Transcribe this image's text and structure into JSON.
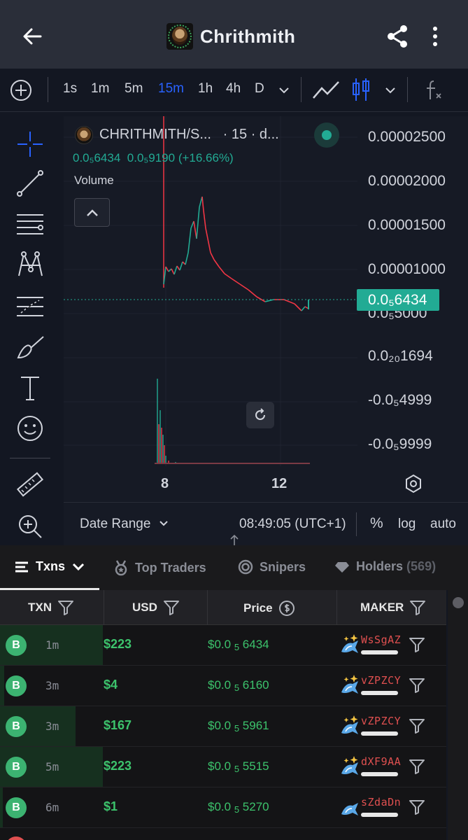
{
  "header": {
    "title": "Chrithmith",
    "icons": {
      "back": "arrow-left-icon",
      "share": "share-icon",
      "more": "more-vertical-icon"
    }
  },
  "toolbar": {
    "intervals": [
      "1s",
      "1m",
      "5m",
      "15m",
      "1h",
      "4h",
      "D"
    ],
    "active_interval": "15m",
    "icons": [
      "add-icon",
      "chevron-down-icon",
      "line-chart-icon",
      "candles-icon",
      "chevron-down-icon",
      "function-icon"
    ]
  },
  "left_tools": [
    "crosshair-icon",
    "trendline-icon",
    "fib-icon",
    "pattern-icon",
    "forecast-icon",
    "brush-icon",
    "text-icon",
    "emoji-icon",
    "ruler-icon",
    "zoom-icon"
  ],
  "chart": {
    "symbol": "CHRITHMITH/S...",
    "interval_label": "· 15 · d...",
    "ohlc_a": "0.0₅6434",
    "ohlc_b": "0.0₅9190",
    "change": "(+16.66%)",
    "volume_label": "Volume",
    "price_tag": "0.0₅6434",
    "y_labels": [
      "0.00002500",
      "0.00002000",
      "0.00001500",
      "0.00001000",
      "0.0₅5000",
      "0.0₂₀1694",
      "-0.0₅4999",
      "-0.0₅9999"
    ],
    "x_labels": [
      "8",
      "12"
    ],
    "colors": {
      "up": "#22ab94",
      "down": "#f23645",
      "accent": "#2962ff"
    }
  },
  "chart_bottom": {
    "date_range": "Date Range",
    "time": "08:49:05 (UTC+1)",
    "percent": "%",
    "log": "log",
    "auto": "auto"
  },
  "tabs": [
    {
      "label": "Txns",
      "icon": "list-icon",
      "active": true
    },
    {
      "label": "Top Traders",
      "icon": "medal-icon",
      "active": false
    },
    {
      "label": "Snipers",
      "icon": "target-icon",
      "active": false
    },
    {
      "label": "Holders",
      "count": "(569)",
      "icon": "diamond-icon",
      "active": false
    }
  ],
  "table": {
    "headers": {
      "txn": "TXN",
      "usd": "USD",
      "price": "Price",
      "maker": "MAKER"
    },
    "rows": [
      {
        "type": "B",
        "age": "1m",
        "usd": "$223",
        "price_prefix": "$0.0",
        "price_sub": "5",
        "price_digits": "6434",
        "maker": "WsSgAZ",
        "maker_icon": "sparkle-fish-icon",
        "volume_fraction": 0.23
      },
      {
        "type": "B",
        "age": "3m",
        "usd": "$4",
        "price_prefix": "$0.0",
        "price_sub": "5",
        "price_digits": "6160",
        "maker": "vZPZCY",
        "maker_icon": "sparkle-fish-icon",
        "volume_fraction": 0.01
      },
      {
        "type": "B",
        "age": "3m",
        "usd": "$167",
        "price_prefix": "$0.0",
        "price_sub": "5",
        "price_digits": "5961",
        "maker": "vZPZCY",
        "maker_icon": "sparkle-fish-icon",
        "volume_fraction": 0.17
      },
      {
        "type": "B",
        "age": "5m",
        "usd": "$223",
        "price_prefix": "$0.0",
        "price_sub": "5",
        "price_digits": "5515",
        "maker": "dXF9AA",
        "maker_icon": "sparkle-fish-icon",
        "volume_fraction": 0.23
      },
      {
        "type": "B",
        "age": "6m",
        "usd": "$1",
        "price_prefix": "$0.0",
        "price_sub": "5",
        "price_digits": "5270",
        "maker": "sZdaDn",
        "maker_icon": "fish-icon",
        "volume_fraction": 0.005
      }
    ]
  }
}
